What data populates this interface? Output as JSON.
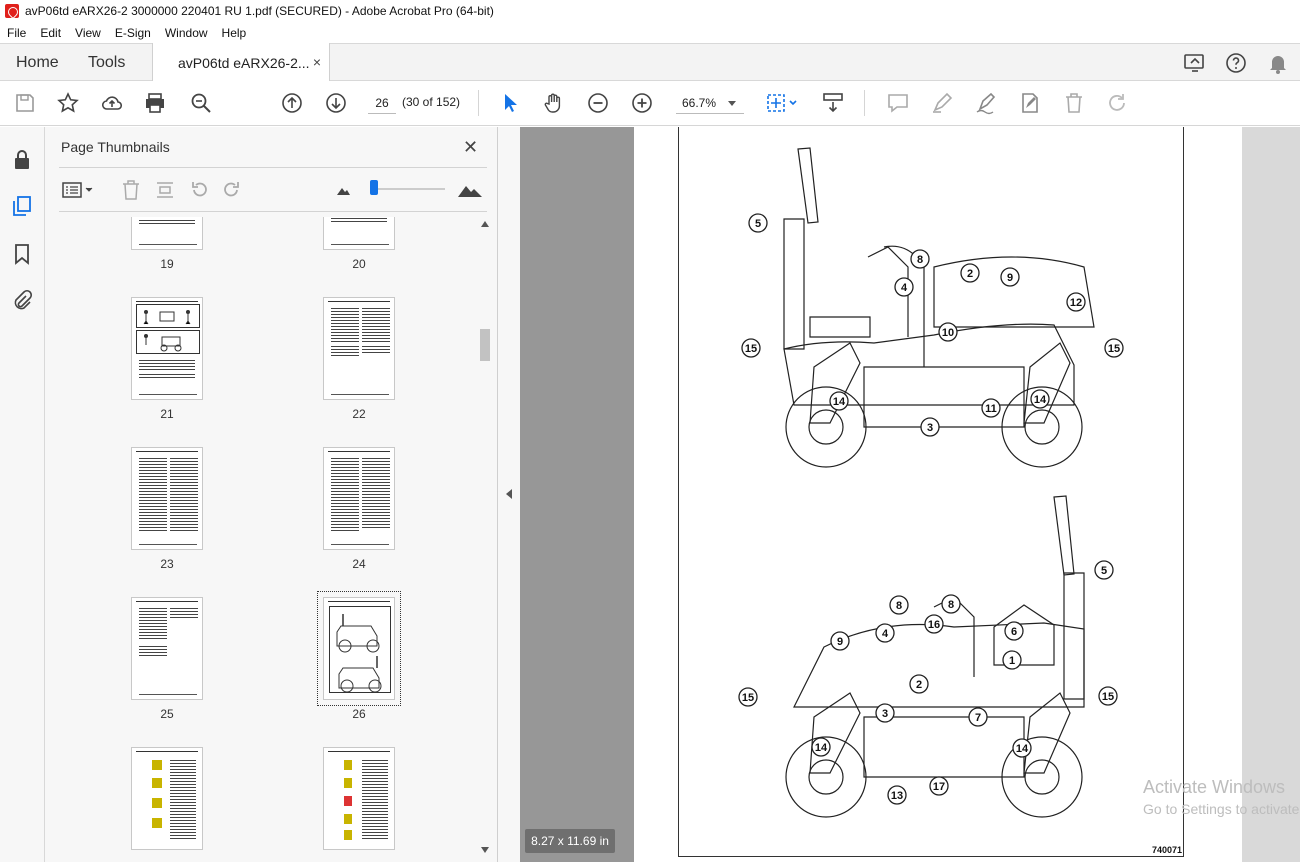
{
  "window": {
    "title": "avP06td eARX26-2 3000000 220401 RU 1.pdf (SECURED) - Adobe Acrobat Pro (64-bit)"
  },
  "menu": [
    "File",
    "Edit",
    "View",
    "E-Sign",
    "Window",
    "Help"
  ],
  "tabs": {
    "home": "Home",
    "tools": "Tools",
    "document": "avP06td eARX26-2...",
    "close": "×"
  },
  "toolbar": {
    "page_number": "26",
    "page_count": "(30 of 152)",
    "zoom": "66.7%"
  },
  "panel": {
    "title": "Page Thumbnails",
    "close": "✕",
    "thumbnails": [
      "19",
      "20",
      "21",
      "22",
      "23",
      "24",
      "25",
      "26"
    ],
    "selected": "26"
  },
  "page": {
    "code": "740071",
    "size_badge": "8.27 x 11.69 in"
  },
  "callouts_top": [
    "5",
    "8",
    "2",
    "9",
    "4",
    "12",
    "10",
    "15",
    "15",
    "11",
    "14",
    "14",
    "3"
  ],
  "callouts_bottom": [
    "5",
    "8",
    "8",
    "9",
    "4",
    "16",
    "6",
    "1",
    "2",
    "15",
    "15",
    "3",
    "7",
    "14",
    "14",
    "13",
    "17"
  ],
  "watermark": {
    "line1": "Activate Windows",
    "line2": "Go to Settings to activate Windows."
  },
  "colors": {
    "accent": "#1473e6",
    "doc_background": "#979797",
    "title_icon": "#e0201b"
  }
}
